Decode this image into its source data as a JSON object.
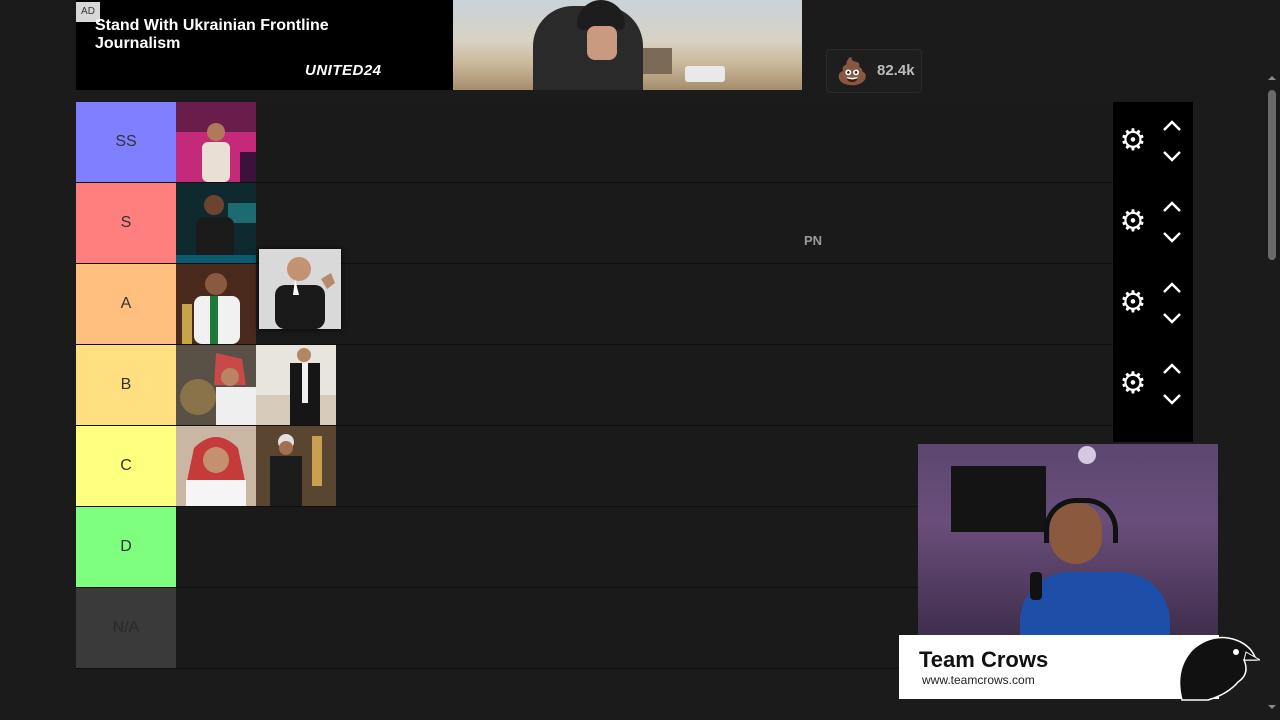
{
  "ad": {
    "badge": "AD",
    "headline": "Stand With Ukrainian Frontline Journalism",
    "brand": "UNITED24"
  },
  "reactions": {
    "icon": "poop-emoji-icon",
    "count": "82.4k"
  },
  "tiers": [
    {
      "label": "SS",
      "color": "#7f7fff"
    },
    {
      "label": "S",
      "color": "#ff7f7f"
    },
    {
      "label": "A",
      "color": "#ffbf7f"
    },
    {
      "label": "B",
      "color": "#ffdf7f"
    },
    {
      "label": "C",
      "color": "#ffff7f"
    },
    {
      "label": "D",
      "color": "#7fff7f"
    },
    {
      "label": "N/A",
      "color": "#3a3a3a"
    }
  ],
  "floating_text": "PN",
  "stream_overlay": {
    "team_name": "Team Crows",
    "url": "www.teamcrows.com"
  }
}
